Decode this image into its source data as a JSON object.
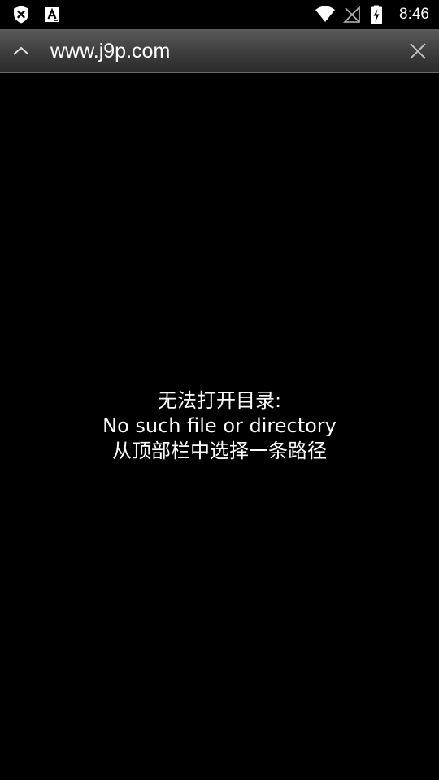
{
  "status_bar": {
    "time": "8:46",
    "left_icons": [
      "shield-x-icon",
      "font-a-icon"
    ],
    "right_icons": [
      "wifi-icon",
      "no-signal-icon",
      "battery-charging-icon"
    ]
  },
  "address_bar": {
    "url": "www.j9p.com",
    "collapse_icon": "chevron-up-icon",
    "close_icon": "close-icon"
  },
  "message": {
    "line1": "无法打开目录:",
    "line2": "No such file or directory",
    "line3": "从顶部栏中选择一条路径"
  }
}
